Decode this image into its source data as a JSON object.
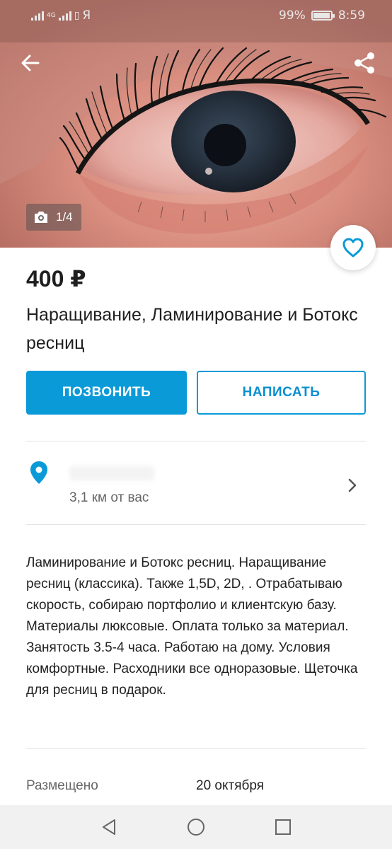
{
  "status_bar": {
    "network": "4G",
    "carrier_glyph": "Я",
    "battery": "99%",
    "time": "8:59"
  },
  "photo": {
    "counter": "1/4",
    "subject": "eye-with-eyelash-extensions"
  },
  "icons": {
    "back": "arrow-left-icon",
    "share": "share-icon",
    "camera": "camera-icon",
    "favorite": "heart-icon",
    "location": "location-pin-icon",
    "chevron": "chevron-right-icon"
  },
  "listing": {
    "price": "400 ₽",
    "title": "Наращивание, Ламинирование и Ботокс  ресниц"
  },
  "actions": {
    "call_label": "ПОЗВОНИТЬ",
    "write_label": "НАПИСАТЬ"
  },
  "location": {
    "distance": "3,1 км от вас"
  },
  "description": "Ламинирование и Ботокс ресниц. Наращивание ресниц (классика). Также 1,5D, 2D, . Отрабатываю скорость, собираю портфолио и клиентскую базу. Материалы люксовые. Оплата только за материал. Занятость 3.5-4 часа. Работаю на дому. Условия комфортные. Расходники все одноразовые. Щеточка для ресниц в подарок.",
  "meta": {
    "posted_label": "Размещено",
    "posted_value": "20 октября"
  },
  "colors": {
    "accent": "#0a9ad8",
    "text_primary": "#1f1f1f",
    "text_secondary": "#666666"
  }
}
